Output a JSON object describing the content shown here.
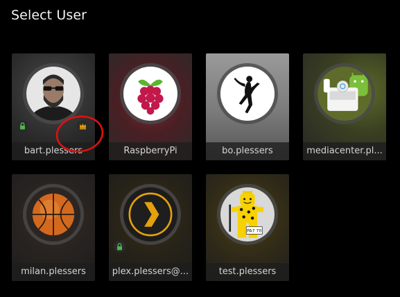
{
  "page": {
    "title": "Select User"
  },
  "users": [
    {
      "name": "bart.plessers",
      "locked": true,
      "admin": true
    },
    {
      "name": "RaspberryPi",
      "locked": false,
      "admin": false
    },
    {
      "name": "bo.plessers",
      "locked": false,
      "admin": false
    },
    {
      "name": "mediacenter.pl...",
      "locked": false,
      "admin": false
    },
    {
      "name": "milan.plessers",
      "locked": false,
      "admin": false
    },
    {
      "name": "plex.plessers@...",
      "locked": true,
      "admin": false
    },
    {
      "name": "test.plessers",
      "locked": false,
      "admin": false
    }
  ],
  "icons": {
    "lock": "lock-icon",
    "admin": "crown-icon"
  },
  "colors": {
    "badge_icon": "#52b54b",
    "crown_icon": "#e5a00d",
    "annotation": "#e01010",
    "plex_orange": "#e5a00d"
  },
  "lego_sign": "PA7 70"
}
